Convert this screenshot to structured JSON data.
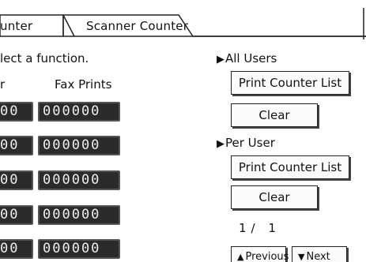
{
  "tabs": [
    {
      "label": "unter"
    },
    {
      "label": "Scanner Counter"
    }
  ],
  "hint": "lect a function.",
  "columns": {
    "left_fragment": "r",
    "fax_prints": "Fax Prints"
  },
  "counters": {
    "left": [
      "00",
      "00",
      "00",
      "00",
      "00"
    ],
    "fax": [
      "000000",
      "000000",
      "000000",
      "000000",
      "000000"
    ]
  },
  "all_users": {
    "heading": "All Users",
    "print_list": "Print Counter List",
    "clear": "Clear"
  },
  "per_user": {
    "heading": "Per User",
    "print_list": "Print Counter List",
    "clear": "Clear"
  },
  "paging": {
    "indicator": "1/ 1",
    "previous": "Previous",
    "next": "Next"
  },
  "icons": {
    "section_marker": "right-triangle-icon",
    "prev_arrow": "up-triangle-icon",
    "next_arrow": "down-triangle-icon"
  }
}
